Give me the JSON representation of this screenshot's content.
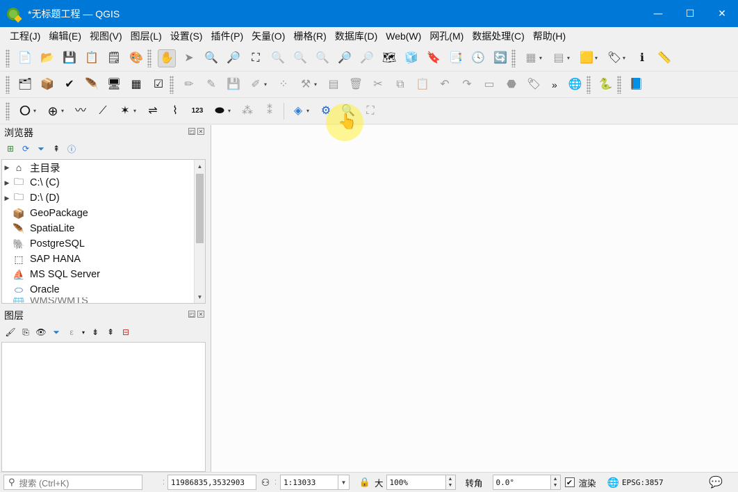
{
  "window": {
    "title": "*无标题工程 — QGIS",
    "minimize": "—",
    "maximize": "☐",
    "close": "✕"
  },
  "menu": [
    "工程(J)",
    "编辑(E)",
    "视图(V)",
    "图层(L)",
    "设置(S)",
    "插件(P)",
    "矢量(O)",
    "栅格(R)",
    "数据库(D)",
    "Web(W)",
    "网孔(M)",
    "数据处理(C)",
    "帮助(H)"
  ],
  "browser": {
    "title": "浏览器",
    "items": [
      {
        "label": "主目录",
        "icon": "home-folder-icon",
        "expandable": true
      },
      {
        "label": "C:\\ (C)",
        "icon": "folder-icon",
        "expandable": true
      },
      {
        "label": "D:\\ (D)",
        "icon": "folder-icon",
        "expandable": true
      },
      {
        "label": "GeoPackage",
        "icon": "geopackage-icon",
        "expandable": false
      },
      {
        "label": "SpatiaLite",
        "icon": "spatialite-feather-icon",
        "expandable": false
      },
      {
        "label": "PostgreSQL",
        "icon": "postgresql-elephant-icon",
        "expandable": false
      },
      {
        "label": "SAP HANA",
        "icon": "sap-hana-icon",
        "expandable": false
      },
      {
        "label": "MS SQL Server",
        "icon": "mssql-icon",
        "expandable": false
      },
      {
        "label": "Oracle",
        "icon": "oracle-icon",
        "expandable": false
      },
      {
        "label": "WMS/WMTS",
        "icon": "wms-globe-icon",
        "expandable": false
      }
    ]
  },
  "layers": {
    "title": "图层"
  },
  "status": {
    "search_placeholder": "搜索 (Ctrl+K)",
    "coordinate": "11986835,3532903",
    "scale": "1:13033",
    "magnifier_label": "大",
    "magnifier_value": "100%",
    "rotation_label": "转角",
    "rotation_value": "0.0°",
    "render_label": "渲染",
    "render_checked": true,
    "crs": "EPSG:3857"
  },
  "colors": {
    "titlebar": "#0078d7",
    "canvas": "#fcfcfd",
    "cursor_highlight": "#fff03c"
  }
}
